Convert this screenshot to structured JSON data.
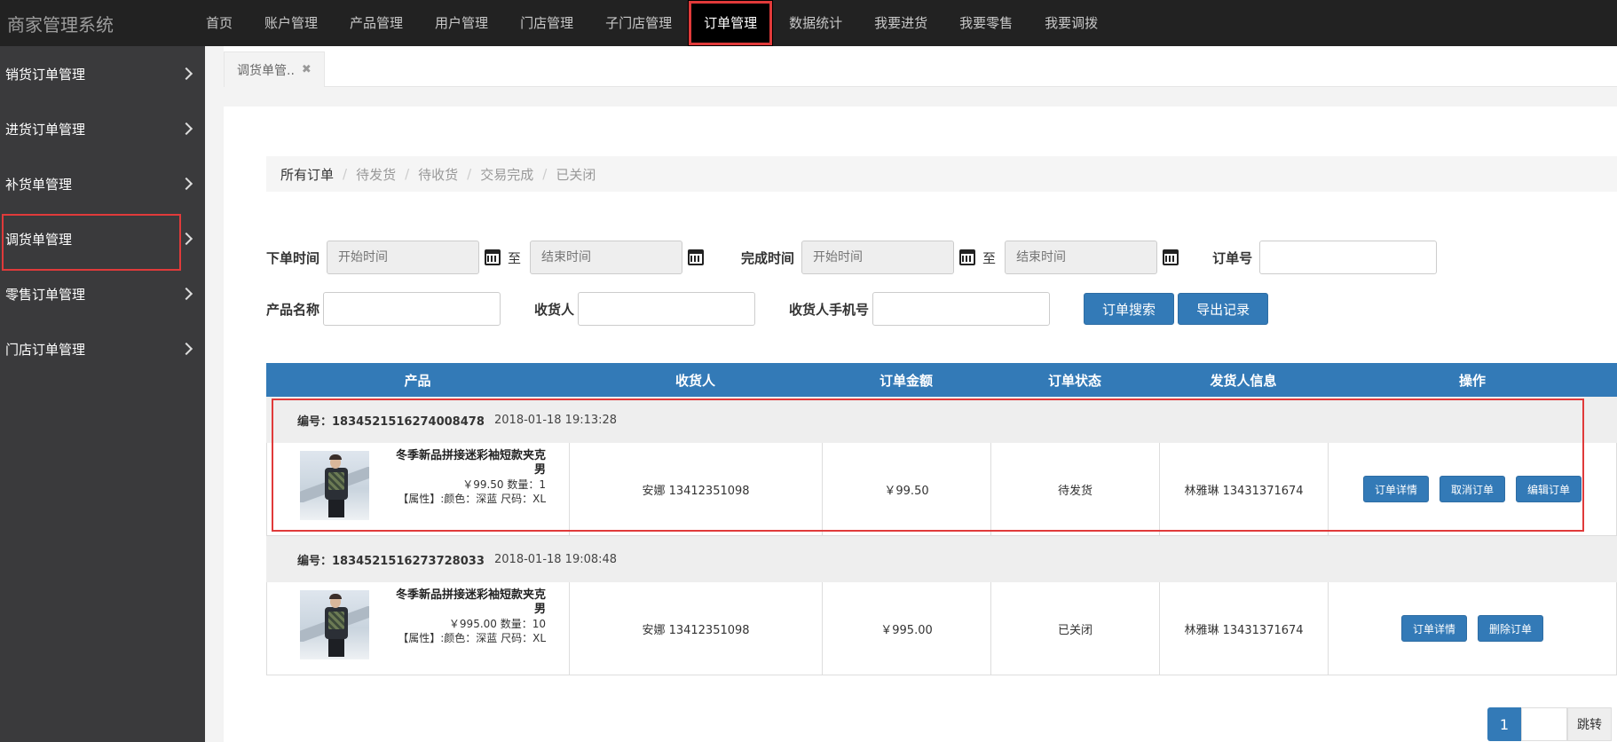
{
  "brand": "商家管理系统",
  "top_nav": [
    {
      "label": "首页"
    },
    {
      "label": "账户管理"
    },
    {
      "label": "产品管理"
    },
    {
      "label": "用户管理"
    },
    {
      "label": "门店管理"
    },
    {
      "label": "子门店管理"
    },
    {
      "label": "订单管理",
      "active": true
    },
    {
      "label": "数据统计"
    },
    {
      "label": "我要进货"
    },
    {
      "label": "我要零售"
    },
    {
      "label": "我要调拨"
    }
  ],
  "sidebar": [
    {
      "label": "销货订单管理"
    },
    {
      "label": "进货订单管理"
    },
    {
      "label": "补货单管理"
    },
    {
      "label": "调货单管理",
      "selected": true
    },
    {
      "label": "零售订单管理"
    },
    {
      "label": "门店订单管理"
    }
  ],
  "tab": {
    "label": "调货单管..",
    "close": "✖"
  },
  "breadcrumb": [
    "所有订单",
    "待发货",
    "待收货",
    "交易完成",
    "已关闭"
  ],
  "filters": {
    "order_time_label": "下单时间",
    "start_placeholder": "开始时间",
    "end_placeholder": "结束时间",
    "to": "至",
    "finish_time_label": "完成时间",
    "order_no_label": "订单号",
    "product_name_label": "产品名称",
    "receiver_label": "收货人",
    "receiver_phone_label": "收货人手机号",
    "search_button": "订单搜索",
    "export_button": "导出记录"
  },
  "table": {
    "headers": [
      "产品",
      "收货人",
      "订单金额",
      "订单状态",
      "发货人信息",
      "操作"
    ],
    "orders": [
      {
        "id_label": "编号：1834521516274008478",
        "time": "2018-01-18 19:13:28",
        "product_name": "冬季新品拼接迷彩袖短款夹克男",
        "price_qty": "￥99.50 数量：1",
        "attrs": "【属性】:颜色：深蓝 尺码：XL",
        "receiver": "安娜 13412351098",
        "amount": "￥99.50",
        "status": "待发货",
        "shipper": "林雅琳 13431371674",
        "actions": [
          "订单详情",
          "取消订单",
          "编辑订单"
        ]
      },
      {
        "id_label": "编号：1834521516273728033",
        "time": "2018-01-18 19:08:48",
        "product_name": "冬季新品拼接迷彩袖短款夹克男",
        "price_qty": "￥995.00 数量：10",
        "attrs": "【属性】:颜色：深蓝 尺码：XL",
        "receiver": "安娜 13412351098",
        "amount": "￥995.00",
        "status": "已关闭",
        "shipper": "林雅琳 13431371674",
        "actions": [
          "订单详情",
          "删除订单"
        ]
      }
    ]
  },
  "pagination": {
    "current": "1",
    "go": "跳转"
  },
  "colors": {
    "primary": "#337ab7",
    "highlight": "#e03a3a",
    "topbar": "#222222",
    "sidebar": "#3a3a3c"
  }
}
